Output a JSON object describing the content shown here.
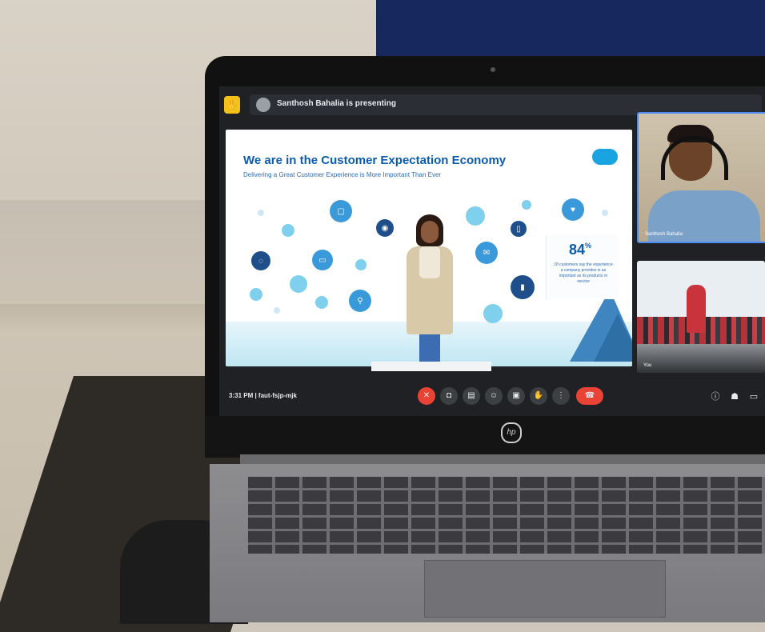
{
  "meeting": {
    "presenting_text": "Santhosh Bahalia is presenting",
    "time_label": "3:31 PM  |  faut-fsjp-mjk",
    "hand_icon": "hand-icon"
  },
  "slide": {
    "title": "We are in the Customer Expectation Economy",
    "subtitle": "Delivering a Great Customer Experience is More Important Than Ever",
    "stat_value": "84",
    "stat_suffix": "%",
    "stat_text": "Of customers say the experience a company provides is as important as its products or service",
    "caption": "",
    "logo": "salesforce-cloud-logo"
  },
  "participants": [
    {
      "name": "Santhosh Bahalia"
    },
    {
      "name": "You"
    }
  ],
  "controls": [
    {
      "name": "mic-off-icon"
    },
    {
      "name": "camera-icon"
    },
    {
      "name": "captions-icon"
    },
    {
      "name": "emoji-icon"
    },
    {
      "name": "present-icon"
    },
    {
      "name": "raise-hand-icon"
    },
    {
      "name": "more-icon"
    },
    {
      "name": "end-call-icon"
    }
  ],
  "right_controls": [
    {
      "name": "info-icon"
    },
    {
      "name": "people-icon"
    },
    {
      "name": "chat-icon"
    }
  ],
  "device": {
    "brand_logo": "hp"
  }
}
